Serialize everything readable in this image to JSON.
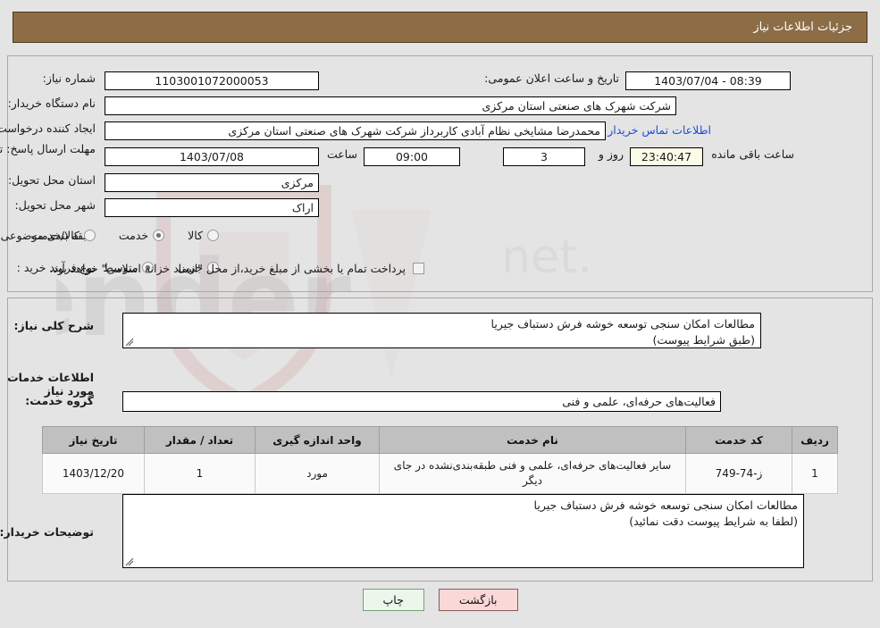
{
  "header": {
    "title": "جزئیات اطلاعات نیاز",
    "bg_color": "#8c6d46",
    "text_color": "#ffffff"
  },
  "top_form": {
    "need_number_label": "شماره نیاز:",
    "need_number_value": "1103001072000053",
    "announce_label": "تاریخ و ساعت اعلان عمومی:",
    "announce_value": "08:39 - 1403/07/04",
    "buyer_org_label": "نام دستگاه خریدار:",
    "buyer_org_value": "شرکت شهرک های صنعتی استان مرکزی",
    "creator_label": "ایجاد کننده درخواست:",
    "creator_value": "محمدرضا مشایخی نظام آبادی کاربرداز شرکت شهرک های صنعتی استان مرکزی",
    "contact_link": "اطلاعات تماس خریدار",
    "deadline_label": "مهلت ارسال پاسخ: تا تاریخ:",
    "deadline_date": "1403/07/08",
    "time_label": "ساعت",
    "deadline_time": "09:00",
    "days_value": "3",
    "days_label": "روز و",
    "countdown_value": "23:40:47",
    "remaining_label": "ساعت باقی مانده",
    "province_label": "استان محل تحویل:",
    "province_value": "مرکزی",
    "city_label": "شهر محل تحویل:",
    "city_value": "اراک",
    "category_label": "طبقه بندی موضوعی:",
    "category_options": [
      {
        "label": "کالا",
        "selected": false
      },
      {
        "label": "خدمت",
        "selected": true
      },
      {
        "label": "کالا/خدمت",
        "selected": false
      }
    ],
    "process_label": "نوع فرآیند خرید :",
    "process_options": [
      {
        "label": "جزیی",
        "selected": false
      },
      {
        "label": "متوسط",
        "selected": true
      }
    ],
    "payment_checkbox_checked": false,
    "payment_note": "پرداخت تمام یا بخشی از مبلغ خرید،از محل \"اسناد خزانه اسلامی\" خواهد بود."
  },
  "bottom": {
    "general_desc_label": "شرح کلی نیاز:",
    "general_desc_value": "مطالعات امکان سنجی توسعه خوشه فرش دستباف جیریا\n(طبق شرایط پیوست)",
    "services_section_title": "اطلاعات خدمات مورد نیاز",
    "service_group_label": "گروه خدمت:",
    "service_group_value": "فعالیت‌های حرفه‌ای، علمی و فنی",
    "table": {
      "columns": [
        "ردیف",
        "کد خدمت",
        "نام خدمت",
        "واحد اندازه گیری",
        "تعداد / مقدار",
        "تاریخ نیاز"
      ],
      "rows": [
        {
          "row_no": "1",
          "service_code": "ز-74-749",
          "service_name": "سایر فعالیت‌های حرفه‌ای، علمی و فنی طبقه‌بندی‌نشده در جای دیگر",
          "unit": "مورد",
          "quantity": "1",
          "need_date": "1403/12/20"
        }
      ]
    },
    "buyer_notes_label": "توضیحات خریدار:",
    "buyer_notes_value": "مطالعات امکان سنجی توسعه خوشه فرش دستباف جیریا\n(لطفا به شرایط پیوست دقت نمائید)"
  },
  "footer": {
    "print_label": "چاپ",
    "back_label": "بازگشت"
  },
  "watermark": {
    "text": "AriaTender.net"
  }
}
